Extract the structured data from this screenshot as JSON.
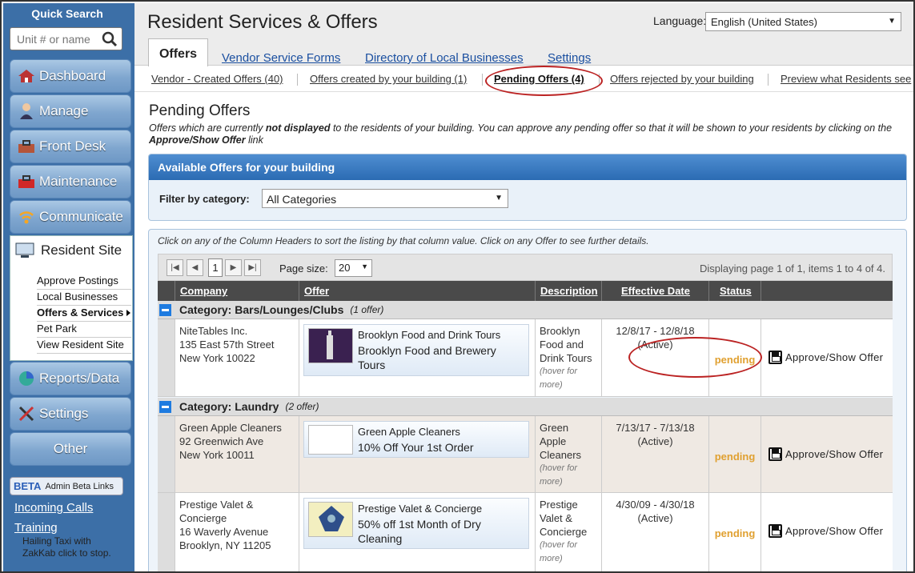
{
  "sidebar": {
    "quick_search_title": "Quick Search",
    "search_placeholder": "Unit # or name",
    "nav": [
      {
        "label": "Dashboard",
        "icon": "house-icon"
      },
      {
        "label": "Manage",
        "icon": "person-icon"
      },
      {
        "label": "Front Desk",
        "icon": "toolbox-icon"
      },
      {
        "label": "Maintenance",
        "icon": "toolbox-red-icon"
      },
      {
        "label": "Communicate",
        "icon": "wifi-icon"
      }
    ],
    "resident_site_label": "Resident Site",
    "resident_items": [
      "Approve Postings",
      "Local Businesses",
      "Offers & Services",
      "Pet Park",
      "View Resident Site"
    ],
    "nav_bottom": [
      {
        "label": "Reports/Data",
        "icon": "pie-chart-icon"
      },
      {
        "label": "Settings",
        "icon": "tools-icon"
      },
      {
        "label": "Other",
        "icon": ""
      }
    ],
    "beta_tag": "BETA",
    "beta_label": "Admin Beta Links",
    "incoming_calls": "Incoming Calls",
    "training": "Training",
    "broken_image_text": "Hailing Taxi with ZakKab click to stop."
  },
  "header": {
    "title": "Resident Services & Offers",
    "language_label": "Language:",
    "language_value": "English (United States)"
  },
  "tabs": [
    "Offers",
    "Vendor Service Forms",
    "Directory of Local Businesses",
    "Settings"
  ],
  "subtabs": [
    "Vendor - Created Offers (40)",
    "Offers created by your building (1)",
    "Pending Offers (4)",
    "Offers rejected by your building",
    "Preview what Residents see"
  ],
  "content": {
    "heading": "Pending Offers",
    "desc_1": "Offers which are currently ",
    "desc_bold": "not displayed",
    "desc_2": " to the residents of your building. You can approve any pending offer so that it will be shown to your residents by clicking on the ",
    "desc_bold2": "Approve/Show Offer",
    "desc_3": " link",
    "panel_title": "Available Offers for your building",
    "filter_label": "Filter by category:",
    "filter_value": "All Categories",
    "grid_hint": "Click on any of the Column Headers to sort the listing by that column value. Click on any Offer to see further details.",
    "page_num": "1",
    "page_size_label": "Page size:",
    "page_size": "20",
    "pager_info": "Displaying page 1 of 1, items 1 to 4 of 4.",
    "columns": [
      "Company",
      "Offer",
      "Description",
      "Effective Date",
      "Status"
    ],
    "categories": [
      {
        "name": "Category: Bars/Lounges/Clubs",
        "count": "(1 offer)"
      },
      {
        "name": "Category: Laundry",
        "count": "(2 offer)"
      }
    ],
    "rows": [
      {
        "company": [
          "NiteTables Inc.",
          "135 East 57th Street",
          "New York 10022"
        ],
        "offer_vendor": "Brooklyn Food and Drink Tours",
        "offer_title": "Brooklyn Food and Brewery Tours",
        "description": [
          "Brooklyn",
          "Food and",
          "Drink Tours"
        ],
        "hover": "(hover for more)",
        "dates": "12/8/17 - 12/8/18",
        "active": "(Active)",
        "status": "pending",
        "action": "Approve/Show Offer"
      },
      {
        "company": [
          "Green Apple Cleaners",
          "92 Greenwich Ave",
          "New York 10011"
        ],
        "offer_vendor": "Green Apple Cleaners",
        "offer_title": "10% Off Your 1st Order",
        "description": [
          "Green",
          "Apple",
          "Cleaners"
        ],
        "hover": "(hover for more)",
        "dates": "7/13/17 - 7/13/18",
        "active": "(Active)",
        "status": "pending",
        "action": "Approve/Show Offer"
      },
      {
        "company": [
          "Prestige Valet &",
          "Concierge",
          "16 Waverly Avenue",
          "Brooklyn, NY 11205"
        ],
        "offer_vendor": "Prestige Valet & Concierge",
        "offer_title": "50% off 1st Month of Dry Cleaning",
        "description": [
          "Prestige",
          "Valet &",
          "Concierge"
        ],
        "hover": "(hover for more)",
        "dates": "4/30/09 - 4/30/18",
        "active": "(Active)",
        "status": "pending",
        "action": "Approve/Show Offer"
      }
    ]
  },
  "colors": {
    "sidebar": "#3c6fa7",
    "status_pending": "#e0a030",
    "annotation": "#bb2222",
    "panel_header": "#2b6bb3"
  }
}
